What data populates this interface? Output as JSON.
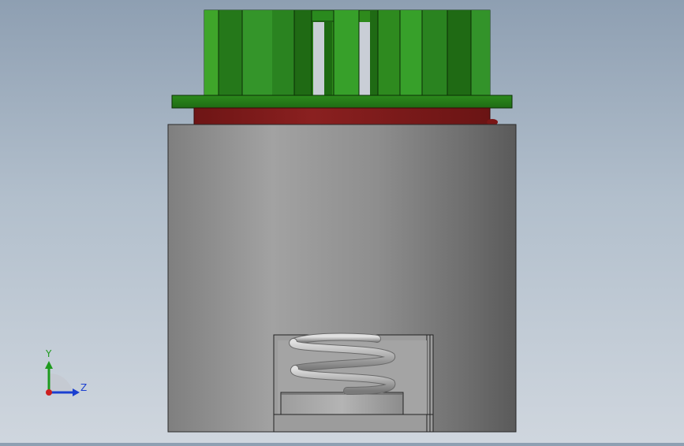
{
  "viewport": {
    "background_top": "#8e9fb2",
    "background_bottom": "#cfd6de"
  },
  "model": {
    "fan_color": "#2f8a1e",
    "fan_dark": "#1d5f12",
    "base_color": "#8a1d1d",
    "body_color": "#9a9a9a",
    "spring_color": "#b8b8b8"
  },
  "triad": {
    "y_label": "Y",
    "z_label": "Z",
    "y_color": "#1e9a1e",
    "z_color": "#1a3fd0",
    "x_color": "#cc1f1f"
  }
}
